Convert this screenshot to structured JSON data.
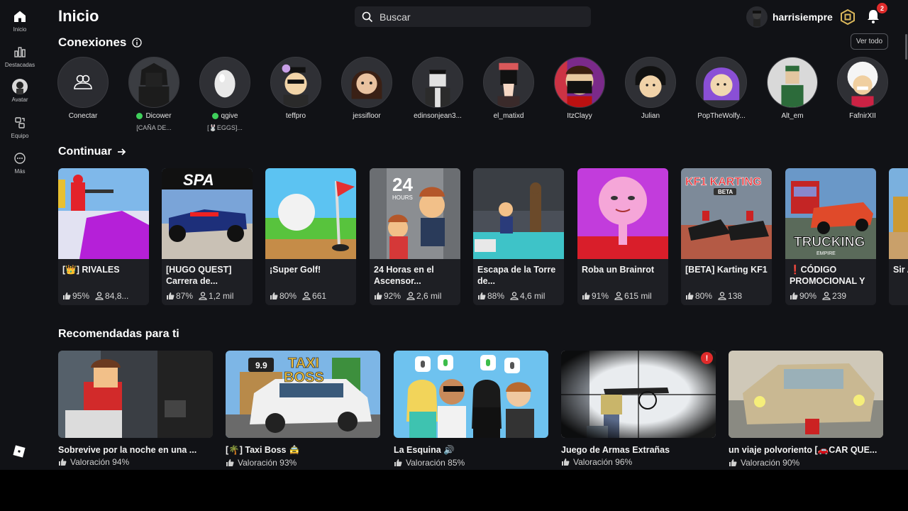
{
  "sidebar": {
    "items": [
      {
        "label": "Inicio",
        "icon": "home-icon"
      },
      {
        "label": "Destacadas",
        "icon": "chart-icon"
      },
      {
        "label": "Avatar",
        "icon": "avatar-icon"
      },
      {
        "label": "Equipo",
        "icon": "team-icon"
      },
      {
        "label": "Más",
        "icon": "more-icon"
      }
    ]
  },
  "header": {
    "title": "Inicio",
    "search_placeholder": "Buscar",
    "username": "harrisiempre",
    "notification_count": "2"
  },
  "connections": {
    "title": "Conexiones",
    "view_all": "Ver todo",
    "items": [
      {
        "name": "Conectar",
        "status": "",
        "online": false
      },
      {
        "name": "Dicower",
        "status": "[CAÑA DE...",
        "online": true
      },
      {
        "name": "qgive",
        "status": "[🐰EGGS]...",
        "online": true
      },
      {
        "name": "teffpro",
        "status": "",
        "online": false
      },
      {
        "name": "jessifloor",
        "status": "",
        "online": false
      },
      {
        "name": "edinsonjean3...",
        "status": "",
        "online": false
      },
      {
        "name": "el_matixd",
        "status": "",
        "online": false
      },
      {
        "name": "ItzClayy",
        "status": "",
        "online": false
      },
      {
        "name": "Julian",
        "status": "",
        "online": false
      },
      {
        "name": "PopTheWolfy...",
        "status": "",
        "online": false
      },
      {
        "name": "Alt_em",
        "status": "",
        "online": false
      },
      {
        "name": "FafnirXII",
        "status": "",
        "online": false
      }
    ]
  },
  "continue": {
    "title": "Continuar",
    "games": [
      {
        "title": "[👑] RIVALES",
        "rating": "95%",
        "players": "84,8..."
      },
      {
        "title": "[HUGO QUEST] Carrera de...",
        "rating": "87%",
        "players": "1,2 mil"
      },
      {
        "title": "¡Super Golf!",
        "rating": "80%",
        "players": "661"
      },
      {
        "title": "24 Horas en el Ascensor...",
        "rating": "92%",
        "players": "2,6 mil"
      },
      {
        "title": "Escapa de la Torre de...",
        "rating": "88%",
        "players": "4,6 mil"
      },
      {
        "title": "Roba un Brainrot",
        "rating": "91%",
        "players": "615 mil"
      },
      {
        "title": "[BETA] Karting KF1",
        "rating": "80%",
        "players": "138"
      },
      {
        "title": "❗CÓDIGO PROMOCIONAL Y",
        "rating": "90%",
        "players": "239"
      },
      {
        "title": "Sir Au",
        "rating": "",
        "players": ""
      }
    ]
  },
  "recommended": {
    "title": "Recomendadas para ti",
    "games": [
      {
        "title": "Sobrevive por la noche en una ...",
        "rating": "Valoración 94%"
      },
      {
        "title": "[🌴] Taxi Boss 🚖",
        "rating": "Valoración 93%"
      },
      {
        "title": "La Esquina 🔊",
        "rating": "Valoración 85%"
      },
      {
        "title": "Juego de Armas Extrañas",
        "rating": "Valoración 96%"
      },
      {
        "title": "un viaje polvoriento [🚗CAR QUE...",
        "rating": "Valoración 90%"
      }
    ]
  },
  "thumb_texts": {
    "spa": "SPA",
    "hours": "24",
    "hours_sub": "HOURS",
    "kf1": "KF1 KARTING",
    "beta": "BETA",
    "trucking": "TRUCKING",
    "empire": "EMPIRE",
    "taxi": "TAXI",
    "boss": "BOSS",
    "x99": "9.9"
  },
  "colors": {
    "background": "#111216",
    "card": "#1e1f24",
    "online": "#3fcf5b",
    "badge": "#e02b2b"
  }
}
